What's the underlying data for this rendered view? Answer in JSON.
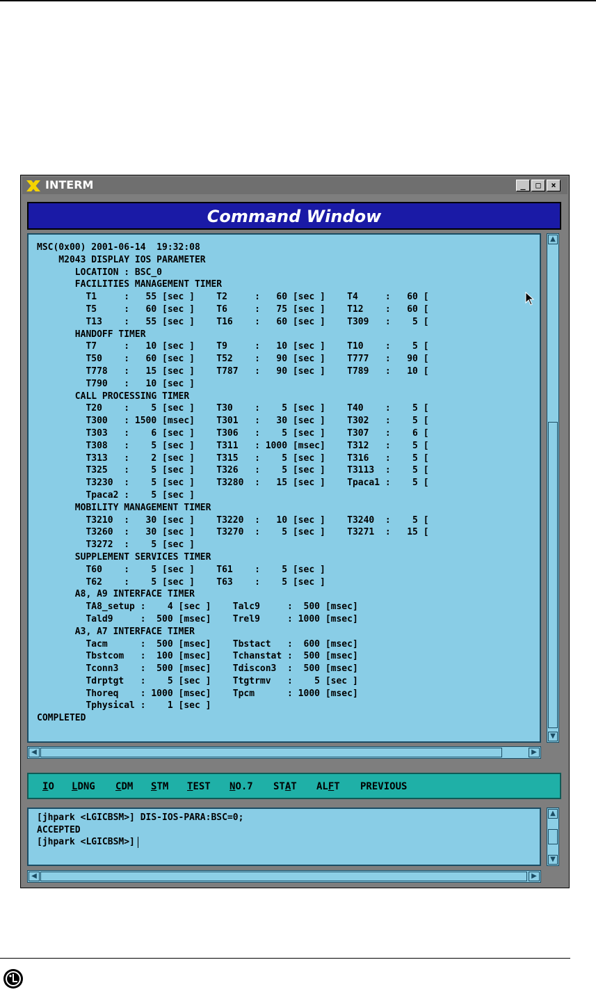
{
  "window": {
    "title": "INTERM",
    "controls": {
      "minimize": "_",
      "maximize": "□",
      "close": "×"
    }
  },
  "command_window": {
    "header": "Command Window"
  },
  "output": {
    "lines": [
      "MSC(0x00) 2001-06-14  19:32:08",
      "    M2043 DISPLAY IOS PARAMETER",
      "       LOCATION : BSC_0",
      "       FACILITIES MANAGEMENT TIMER",
      "         T1     :   55 [sec ]    T2     :   60 [sec ]    T4     :   60 [",
      "         T5     :   60 [sec ]    T6     :   75 [sec ]    T12    :   60 [",
      "         T13    :   55 [sec ]    T16    :   60 [sec ]    T309   :    5 [",
      "       HANDOFF TIMER",
      "         T7     :   10 [sec ]    T9     :   10 [sec ]    T10    :    5 [",
      "         T50    :   60 [sec ]    T52    :   90 [sec ]    T777   :   90 [",
      "         T778   :   15 [sec ]    T787   :   90 [sec ]    T789   :   10 [",
      "         T790   :   10 [sec ]",
      "       CALL PROCESSING TIMER",
      "         T20    :    5 [sec ]    T30    :    5 [sec ]    T40    :    5 [",
      "         T300   : 1500 [msec]    T301   :   30 [sec ]    T302   :    5 [",
      "         T303   :    6 [sec ]    T306   :    5 [sec ]    T307   :    6 [",
      "         T308   :    5 [sec ]    T311   : 1000 [msec]    T312   :    5 [",
      "         T313   :    2 [sec ]    T315   :    5 [sec ]    T316   :    5 [",
      "         T325   :    5 [sec ]    T326   :    5 [sec ]    T3113  :    5 [",
      "         T3230  :    5 [sec ]    T3280  :   15 [sec ]    Tpaca1 :    5 [",
      "         Tpaca2 :    5 [sec ]",
      "       MOBILITY MANAGEMENT TIMER",
      "         T3210  :   30 [sec ]    T3220  :   10 [sec ]    T3240  :    5 [",
      "         T3260  :   30 [sec ]    T3270  :    5 [sec ]    T3271  :   15 [",
      "         T3272  :    5 [sec ]",
      "       SUPPLEMENT SERVICES TIMER",
      "         T60    :    5 [sec ]    T61    :    5 [sec ]",
      "         T62    :    5 [sec ]    T63    :    5 [sec ]",
      "       A8, A9 INTERFACE TIMER",
      "         TA8_setup :    4 [sec ]    Talc9     :  500 [msec]",
      "         Tald9     :  500 [msec]    Trel9     : 1000 [msec]",
      "       A3, A7 INTERFACE TIMER",
      "         Tacm      :  500 [msec]    Tbstact   :  600 [msec]",
      "         Tbstcom   :  100 [msec]    Tchanstat :  500 [msec]",
      "         Tconn3    :  500 [msec]    Tdiscon3  :  500 [msec]",
      "         Tdrptgt   :    5 [sec ]    Ttgtrmv   :    5 [sec ]",
      "         Thoreq    : 1000 [msec]    Tpcm      : 1000 [msec]",
      "         Tphysical :    1 [sec ]",
      "COMPLETED"
    ]
  },
  "menu": [
    {
      "pre": "",
      "ul": "I",
      "post": "O"
    },
    {
      "pre": "",
      "ul": "L",
      "post": "DNG"
    },
    {
      "pre": "",
      "ul": "C",
      "post": "DM"
    },
    {
      "pre": "",
      "ul": "S",
      "post": "TM"
    },
    {
      "pre": "",
      "ul": "T",
      "post": "EST"
    },
    {
      "pre": "",
      "ul": "N",
      "post": "O.7"
    },
    {
      "pre": "ST",
      "ul": "A",
      "post": "T"
    },
    {
      "pre": "AL",
      "ul": "F",
      "post": "T"
    },
    {
      "pre": "PREVIOUS",
      "ul": "",
      "post": ""
    }
  ],
  "input": {
    "line1": "[jhpark <LGICBSM>] DIS-IOS-PARA:BSC=0;",
    "line2": "ACCEPTED",
    "prompt": "[jhpark <LGICBSM>]"
  },
  "icons": {
    "logo": "lg-logo-icon",
    "window_logo": "x-window-logo-icon",
    "cursor": "mouse-pointer-icon"
  }
}
